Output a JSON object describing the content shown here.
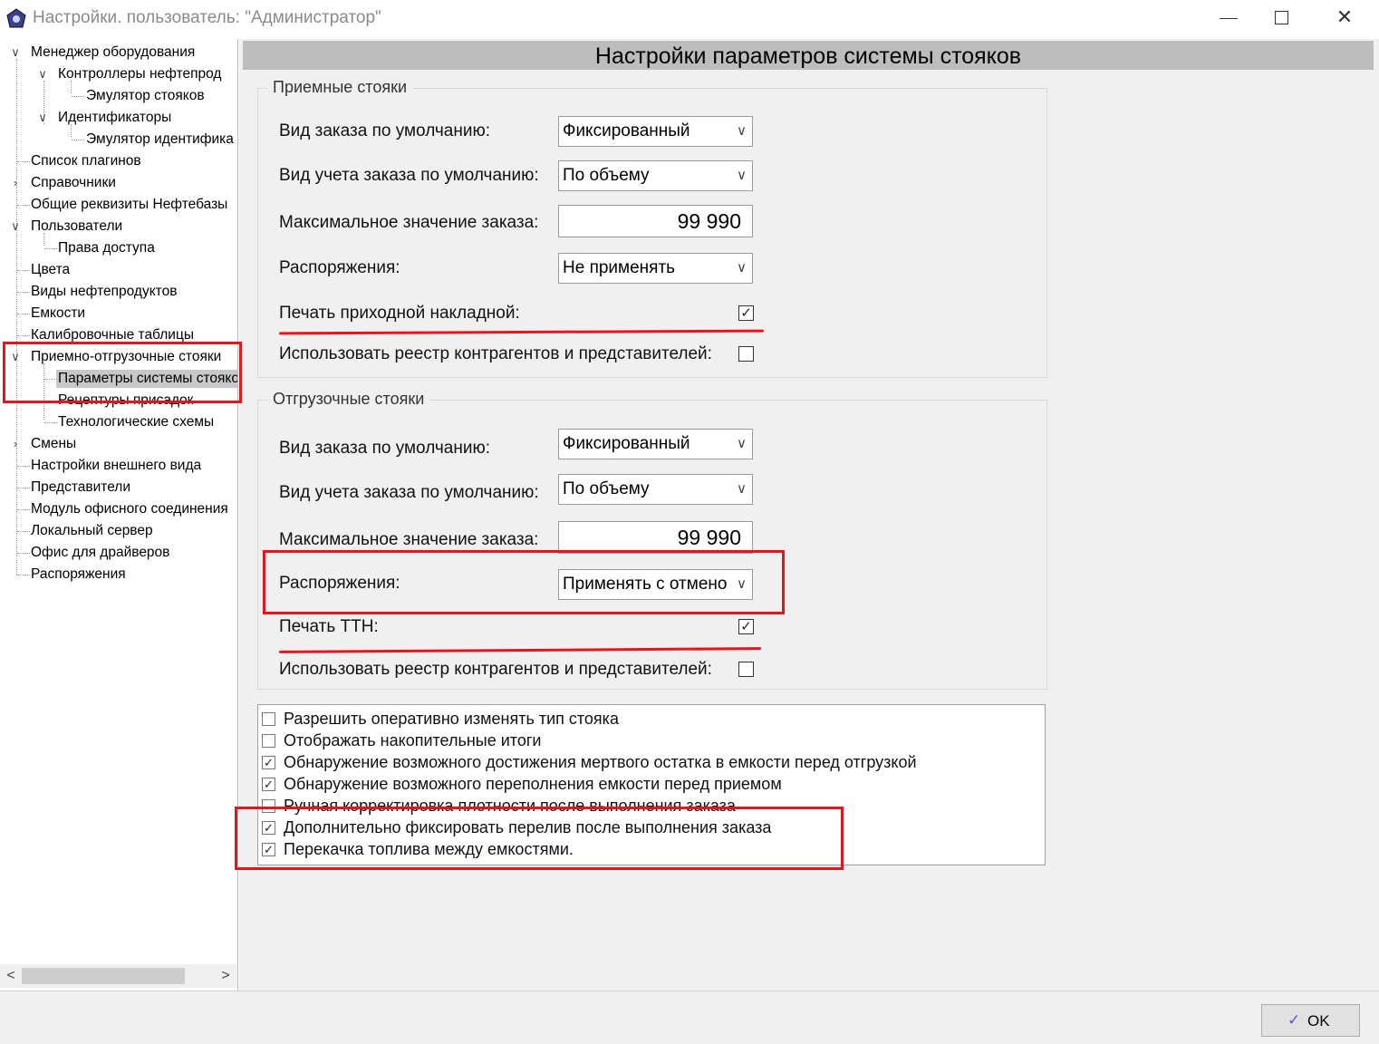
{
  "window": {
    "title": "Настройки. пользователь: \"Администратор\"",
    "close_glyph": "✕"
  },
  "tree": {
    "items": [
      {
        "label": "Менеджер оборудования",
        "toggle": "expanded"
      },
      {
        "label": "Контроллеры нефтепрод",
        "toggle": "expanded"
      },
      {
        "label": "Эмулятор стояков"
      },
      {
        "label": "Идентификаторы",
        "toggle": "expanded"
      },
      {
        "label": "Эмулятор идентифика"
      },
      {
        "label": "Список плагинов"
      },
      {
        "label": "Справочники",
        "toggle": "collapsed"
      },
      {
        "label": "Общие реквизиты Нефтебазы"
      },
      {
        "label": "Пользователи",
        "toggle": "expanded"
      },
      {
        "label": "Права доступа"
      },
      {
        "label": "Цвета"
      },
      {
        "label": "Виды нефтепродуктов"
      },
      {
        "label": "Емкости"
      },
      {
        "label": "Калибровочные таблицы"
      },
      {
        "label": "Приемно-отгрузочные стояки",
        "toggle": "expanded"
      },
      {
        "label": "Параметры системы стояков",
        "selected": true
      },
      {
        "label": "Рецептуры присадок"
      },
      {
        "label": "Технологические схемы"
      },
      {
        "label": "Смены",
        "toggle": "collapsed"
      },
      {
        "label": "Настройки внешнего вида"
      },
      {
        "label": "Представители"
      },
      {
        "label": "Модуль офисного соединения"
      },
      {
        "label": "Локальный сервер"
      },
      {
        "label": "Офис для драйверов"
      },
      {
        "label": "Распоряжения"
      }
    ],
    "scroll_left": "<",
    "scroll_right": ">"
  },
  "main": {
    "header": "Настройки параметров системы стояков",
    "receiving": {
      "title": "Приемные стояки",
      "order_type_label": "Вид заказа по умолчанию:",
      "order_type_value": "Фиксированный",
      "accounting_label": "Вид учета заказа по умолчанию:",
      "accounting_value": "По объему",
      "max_label": "Максимальное значение заказа:",
      "max_value": "99 990",
      "orders_label": "Распоряжения:",
      "orders_value": "Не применять",
      "print_label": "Печать приходной накладной:",
      "print_checked": true,
      "registry_label": "Использовать реестр контрагентов и представителей:",
      "registry_checked": false
    },
    "shipping": {
      "title": "Отгрузочные стояки",
      "order_type_label": "Вид заказа по умолчанию:",
      "order_type_value": "Фиксированный",
      "accounting_label": "Вид учета заказа по умолчанию:",
      "accounting_value": "По объему",
      "max_label": "Максимальное значение заказа:",
      "max_value": "99 990",
      "orders_label": "Распоряжения:",
      "orders_value": "Применять с отмено",
      "print_label": "Печать ТТН:",
      "print_checked": true,
      "registry_label": "Использовать реестр контрагентов и представителей:",
      "registry_checked": false
    },
    "options": [
      {
        "label": "Разрешить оперативно изменять тип стояка",
        "checked": false
      },
      {
        "label": "Отображать накопительные итоги",
        "checked": false
      },
      {
        "label": "Обнаружение возможного достижения мертвого остатка в емкости перед отгрузкой",
        "checked": true
      },
      {
        "label": "Обнаружение возможного переполнения емкости перед приемом",
        "checked": true
      },
      {
        "label": "Ручная корректировка плотности после выполнения заказа",
        "checked": false
      },
      {
        "label": "Дополнительно фиксировать перелив после выполнения заказа",
        "checked": true
      },
      {
        "label": "Перекачка топлива между емкостями.",
        "checked": true
      }
    ]
  },
  "footer": {
    "ok_label": "OK"
  },
  "annotation_color": "#e8141c"
}
